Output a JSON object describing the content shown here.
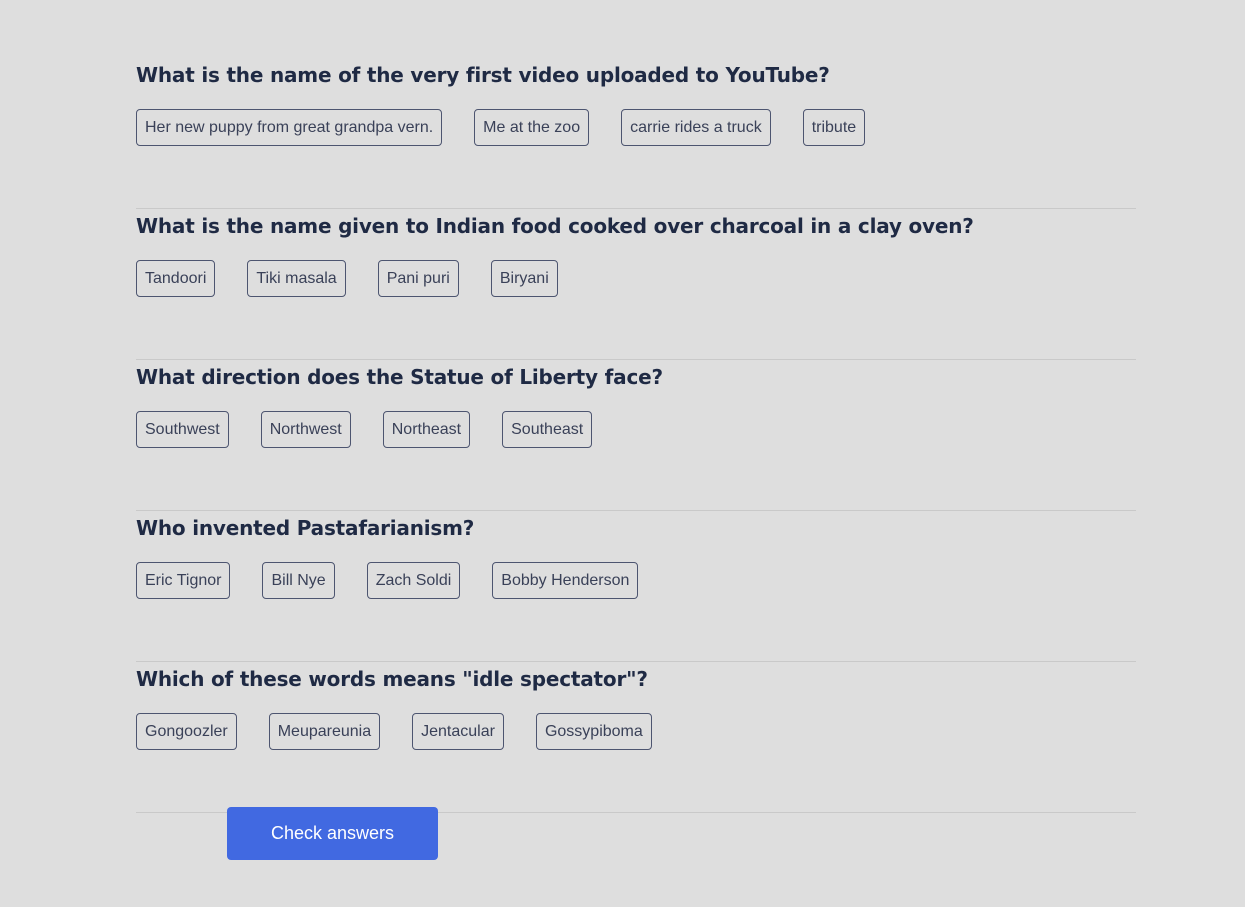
{
  "questions": [
    {
      "text": "What is the name of the very first video uploaded to YouTube?",
      "answers": [
        "Her new puppy from great grandpa vern.",
        "Me at the zoo",
        "carrie rides a truck",
        "tribute"
      ]
    },
    {
      "text": "What is the name given to Indian food cooked over charcoal in a clay oven?",
      "answers": [
        "Tandoori",
        "Tiki masala",
        "Pani puri",
        "Biryani"
      ]
    },
    {
      "text": "What direction does the Statue of Liberty face?",
      "answers": [
        "Southwest",
        "Northwest",
        "Northeast",
        "Southeast"
      ]
    },
    {
      "text": "Who invented Pastafarianism?",
      "answers": [
        "Eric Tignor",
        "Bill Nye",
        "Zach Soldi",
        "Bobby Henderson"
      ]
    },
    {
      "text": "Which of these words means \"idle spectator\"?",
      "answers": [
        "Gongoozler",
        "Meupareunia",
        "Jentacular",
        "Gossypiboma"
      ]
    }
  ],
  "actions": {
    "check_label": "Check answers"
  },
  "colors": {
    "background": "#dedede",
    "question_text": "#1f2a44",
    "answer_border": "#4d5570",
    "primary_button": "#4169e1"
  }
}
